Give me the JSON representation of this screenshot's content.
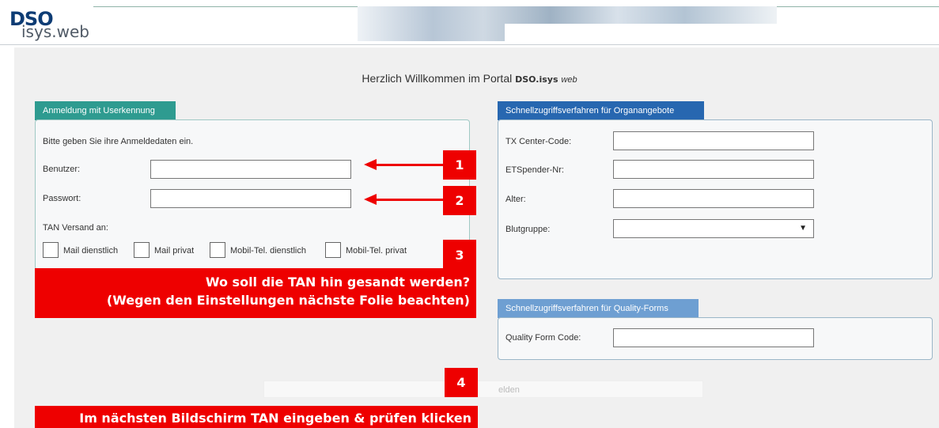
{
  "header": {
    "logo_top": "DSO",
    "logo_bottom": "isys.web"
  },
  "welcome": {
    "text": "Herzlich Willkommen im Portal",
    "brand": "DSO.isys",
    "brand_suffix": "web"
  },
  "login": {
    "tab": "Anmeldung mit Userkennung",
    "intro": "Bitte geben Sie ihre Anmeldedaten ein.",
    "user_label": "Benutzer:",
    "user_value": "",
    "password_label": "Passwort:",
    "password_value": "",
    "tan_label": "TAN Versand an:",
    "tan_options": [
      "Mail dienstlich",
      "Mail privat",
      "Mobil-Tel. dienstlich",
      "Mobil-Tel. privat"
    ]
  },
  "quick_organ": {
    "tab": "Schnellzugriffsverfahren für Organangebote",
    "tx_label": "TX Center-Code:",
    "tx_value": "",
    "et_label": "ETSpender-Nr:",
    "et_value": "",
    "age_label": "Alter:",
    "age_value": "",
    "blood_label": "Blutgruppe:",
    "blood_value": ""
  },
  "quick_quality": {
    "tab": "Schnellzugriffsverfahren für Quality-Forms",
    "code_label": "Quality Form Code:",
    "code_value": ""
  },
  "submit": {
    "label": "elden"
  },
  "annotations": {
    "n1": "1",
    "n2": "2",
    "n3": "3",
    "n4": "4",
    "callout3_line1": "Wo soll die TAN hin gesandt werden?",
    "callout3_line2": "(Wegen den Einstellungen nächste Folie beachten)",
    "callout4": "Im nächsten Bildschirm TAN eingeben & prüfen klicken"
  },
  "colors": {
    "annotation_red": "#ee0000",
    "login_tab": "#2e9b90",
    "organ_tab": "#2767b0",
    "quality_tab": "#6e9fd2"
  }
}
